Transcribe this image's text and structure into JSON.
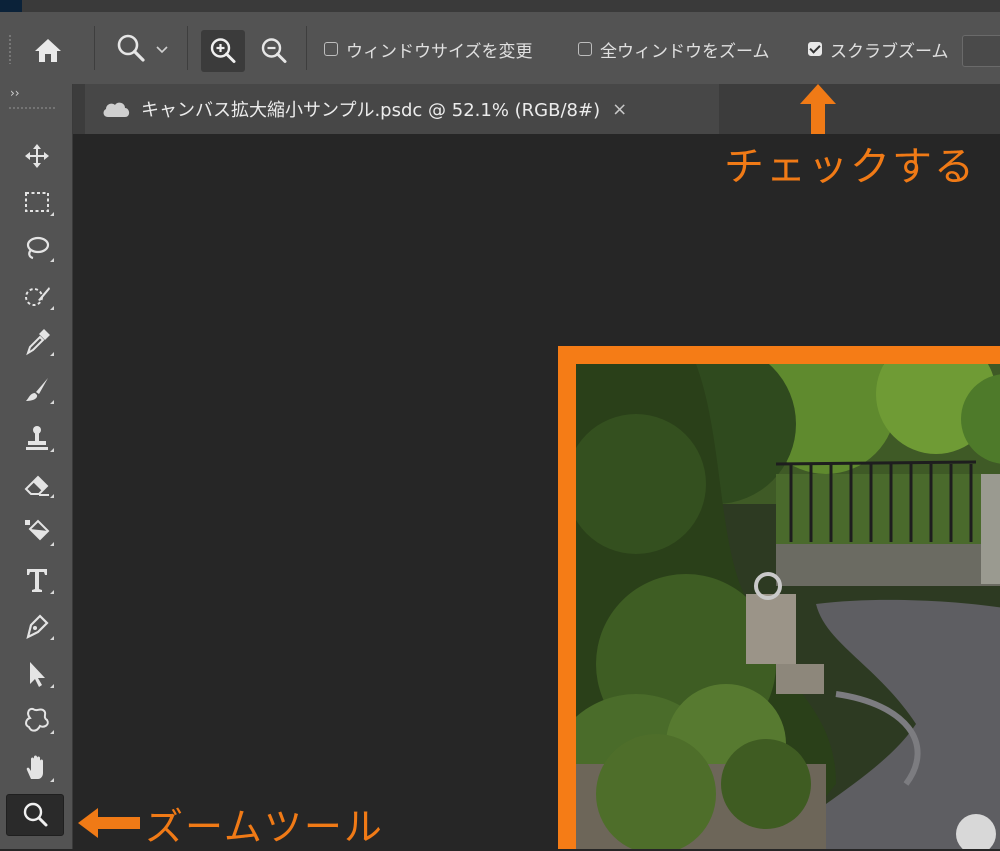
{
  "options_bar": {
    "options": [
      {
        "label": "ウィンドウサイズを変更",
        "checked": false
      },
      {
        "label": "全ウィンドウをズーム",
        "checked": false
      },
      {
        "label": "スクラブズーム",
        "checked": true
      }
    ]
  },
  "icons": {
    "home": "home-icon",
    "zoom_preset": "magnifier-icon",
    "zoom_in": "zoom-in-icon",
    "zoom_out": "zoom-out-icon"
  },
  "document_tab": {
    "title": "キャンバス拡大縮小サンプル.psdc @ 52.1% (RGB/8#)",
    "close_symbol": "×"
  },
  "tools": [
    {
      "icon": "move-icon"
    },
    {
      "icon": "marquee-icon"
    },
    {
      "icon": "lasso-icon"
    },
    {
      "icon": "quick-select-icon"
    },
    {
      "icon": "eyedropper-icon"
    },
    {
      "icon": "brush-icon"
    },
    {
      "icon": "stamp-icon"
    },
    {
      "icon": "eraser-icon"
    },
    {
      "icon": "paint-bucket-icon"
    },
    {
      "icon": "type-icon"
    },
    {
      "icon": "pen-icon"
    },
    {
      "icon": "path-select-icon"
    },
    {
      "icon": "custom-shape-icon"
    },
    {
      "icon": "hand-icon"
    },
    {
      "icon": "zoom-icon",
      "active": true
    }
  ],
  "annotations": {
    "check_label": "チェックする",
    "zoom_tool_label": "ズームツール",
    "color": "#f07a16"
  },
  "colors": {
    "panel": "#535353",
    "canvas_bg": "#262626",
    "highlight_border": "#f57c16"
  }
}
